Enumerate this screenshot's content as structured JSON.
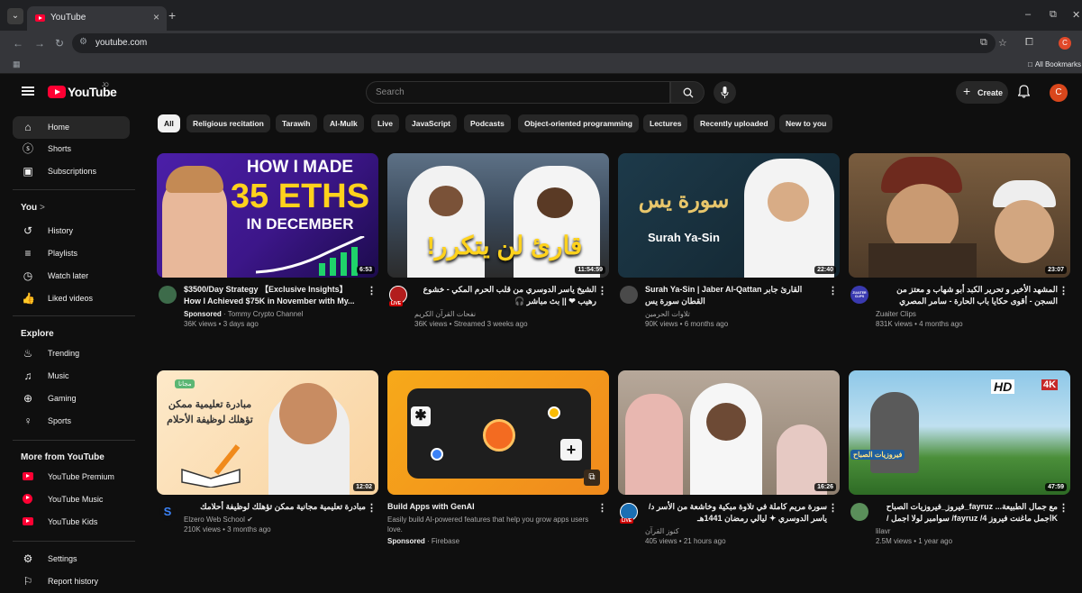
{
  "browser": {
    "tab_title": "YouTube",
    "tab_close": "×",
    "new_tab": "+",
    "url": "youtube.com",
    "all_bookmarks": "All Bookmarks",
    "minimize": "–",
    "restore": "⧉",
    "close": "✕"
  },
  "header": {
    "logo_text": "YouTube",
    "region": "JO",
    "search_placeholder": "Search",
    "create_label": "Create",
    "avatar_letter": "C"
  },
  "sidebar": {
    "main": [
      {
        "label": "Home",
        "icon": "home-icon",
        "active": true
      },
      {
        "label": "Shorts",
        "icon": "shorts-icon"
      },
      {
        "label": "Subscriptions",
        "icon": "subscriptions-icon"
      }
    ],
    "you_header": "You",
    "you_chevron": ">",
    "you": [
      {
        "label": "History",
        "icon": "history-icon"
      },
      {
        "label": "Playlists",
        "icon": "playlists-icon"
      },
      {
        "label": "Watch later",
        "icon": "watch-later-icon"
      },
      {
        "label": "Liked videos",
        "icon": "liked-icon"
      }
    ],
    "explore_header": "Explore",
    "explore": [
      {
        "label": "Trending",
        "icon": "trending-icon"
      },
      {
        "label": "Music",
        "icon": "music-icon"
      },
      {
        "label": "Gaming",
        "icon": "gaming-icon"
      },
      {
        "label": "Sports",
        "icon": "sports-icon"
      }
    ],
    "more_header": "More from YouTube",
    "more": [
      {
        "label": "YouTube Premium"
      },
      {
        "label": "YouTube Music"
      },
      {
        "label": "YouTube Kids"
      }
    ],
    "settings": [
      {
        "label": "Settings",
        "icon": "settings-icon"
      },
      {
        "label": "Report history",
        "icon": "flag-icon"
      }
    ]
  },
  "chips": [
    "All",
    "Religious recitation",
    "Tarawih",
    "Al-Mulk",
    "Live",
    "JavaScript",
    "Podcasts",
    "Object-oriented programming",
    "Lectures",
    "Recently uploaded",
    "New to you"
  ],
  "thumb_text": {
    "v1_line1": "HOW I MADE",
    "v1_line2": "35 ETHS",
    "v1_line3": "IN DECEMBER",
    "v2_overlay": "قارئ لن يتكرر!",
    "v3_overlay": "Surah Ya-Sin",
    "v3_arabic": "سورة يس",
    "v5_badge": "مجانا",
    "v5_line1": "مبادرة تعليمية ممكن",
    "v5_line2": "تؤهلك لوظيفة الأحلام",
    "v6_icon": "✱",
    "v6_plus": "+",
    "v8_hd": "HD",
    "v8_4k": "4K",
    "v8_caption": "فيروزيات الصباح"
  },
  "videos": [
    {
      "title": "$3500/Day Strategy 【Exclusive Insights】 How I Achieved $75K in November with My...",
      "line1_bold": "Sponsored",
      "line1": " · Tommy Crypto Channel",
      "line2": "36K views • 3 days ago",
      "duration": "6:53"
    },
    {
      "title": "الشيخ ياسر الدوسري من قلب الحرم المكي - خشوع رهيب ❤ || بث مباشر 🎧",
      "line1_bold": "",
      "line1": "نفحات القرآن الكريم",
      "line2": "36K views • Streamed 3 weeks ago",
      "duration": "11:54:59",
      "live": "LIVE"
    },
    {
      "title": "Surah Ya-Sin | Jaber Al-Qattan القارئ جابر القطان سورة يس",
      "line1_bold": "",
      "line1": "تلاوات الحرمين",
      "line2": "90K views • 6 months ago",
      "duration": "22:40"
    },
    {
      "title": "المشهد الأخير و تحرير الكبد أبو شهاب و معتز من السجن - أقوى حكايا باب الحارة - سامر المصري",
      "line1_bold": "",
      "line1": "Zuaiter Clips",
      "line2": "831K views • 4 months ago",
      "duration": "23:07",
      "avatar_text": "ZUAITER CLIPS"
    },
    {
      "title": "مبادرة تعليمية مجانية ممكن تؤهلك لوظيفة أحلامك",
      "line1_bold": "",
      "line1": "Elzero Web School ✔",
      "line2": "210K views • 3 months ago",
      "duration": "12:02"
    },
    {
      "title": "Build Apps with GenAI",
      "line1_bold": "",
      "line1": "Easily build AI-powered features that help you grow apps users love.",
      "line2_bold": "Sponsored",
      "line2": " · Firebase",
      "duration": ""
    },
    {
      "title": "سورة مريم كاملة في تلاوة مبكية وخاشعة من الأسر د/ياسر الدوسري ✦ ليالي رمضان 1441هـ",
      "line1_bold": "",
      "line1": "كنوز القرآن",
      "line2": "405 views • 21 hours ago",
      "duration": "16:26",
      "live": "LIVE"
    },
    {
      "title": "مع جمال الطبيعة... fayruz_فيروز_فيروزيات الصباح Kاجمل ماغنت فيروز 4/ fayruz/ سوامبر لولا اجمل /فيروز",
      "line1_bold": "",
      "line1": "lilavr",
      "line2": "2.5M views • 1 year ago",
      "duration": "47:59"
    }
  ]
}
